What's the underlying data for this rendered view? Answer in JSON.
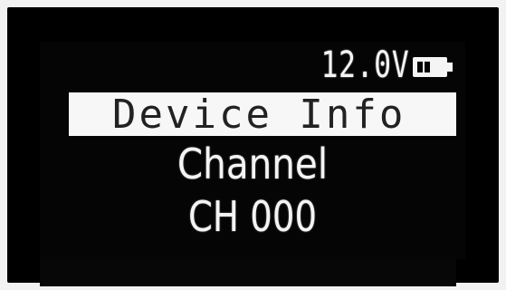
{
  "status": {
    "voltage": "12.0V",
    "battery_icon": "battery-icon",
    "battery_level_bars": 2
  },
  "menu": {
    "title": "Device Info"
  },
  "content": {
    "label": "Channel",
    "value": "CH 000"
  },
  "colors": {
    "screen_bg": "#050505",
    "text": "#f4f4f4",
    "highlight_bg": "#f7f7f7",
    "highlight_text": "#222222"
  }
}
